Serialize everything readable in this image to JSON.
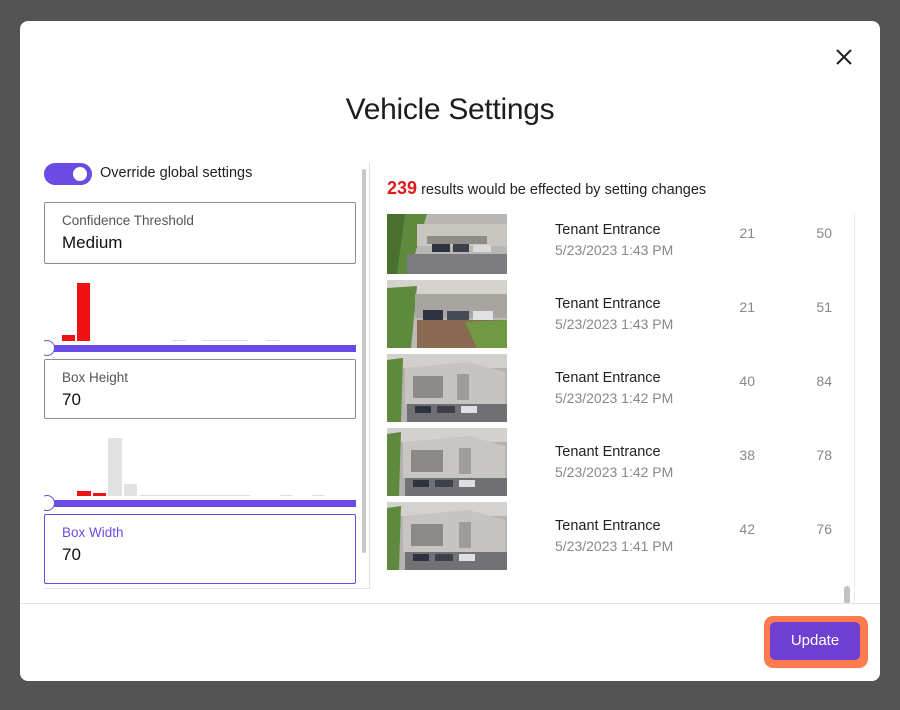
{
  "modal": {
    "title": "Vehicle Settings",
    "close_icon": "close-icon"
  },
  "settings": {
    "override_label": "Override global settings",
    "override_on": true,
    "confidence": {
      "label": "Confidence Threshold",
      "value": "Medium"
    },
    "box_height": {
      "label": "Box Height",
      "value": "70"
    },
    "box_width": {
      "label": "Box Width",
      "value": "70"
    }
  },
  "summary": {
    "count": "239",
    "text": " results would be effected by setting changes"
  },
  "results": [
    {
      "location": "Tenant Entrance",
      "timestamp": "5/23/2023 1:43 PM",
      "v1": "21",
      "v2": "50"
    },
    {
      "location": "Tenant Entrance",
      "timestamp": "5/23/2023 1:43 PM",
      "v1": "21",
      "v2": "51"
    },
    {
      "location": "Tenant Entrance",
      "timestamp": "5/23/2023 1:42 PM",
      "v1": "40",
      "v2": "84"
    },
    {
      "location": "Tenant Entrance",
      "timestamp": "5/23/2023 1:42 PM",
      "v1": "38",
      "v2": "78"
    },
    {
      "location": "Tenant Entrance",
      "timestamp": "5/23/2023 1:41 PM",
      "v1": "42",
      "v2": "76"
    }
  ],
  "footer": {
    "update_label": "Update"
  },
  "colors": {
    "accent": "#6b4be6",
    "highlight": "#ff7a4f",
    "alert": "#e01b1b"
  }
}
